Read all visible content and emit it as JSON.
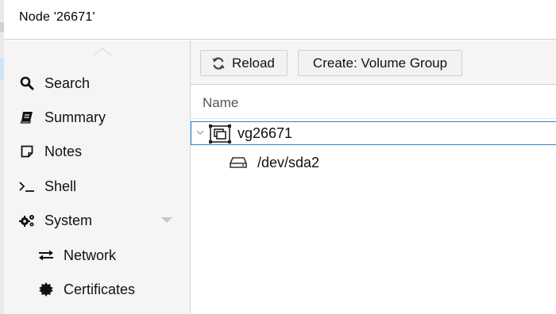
{
  "window": {
    "title": "Node '26671'"
  },
  "nav": {
    "items": [
      {
        "label": "Search",
        "icon": "search-icon"
      },
      {
        "label": "Summary",
        "icon": "book-icon"
      },
      {
        "label": "Notes",
        "icon": "note-icon"
      },
      {
        "label": "Shell",
        "icon": "terminal-icon"
      },
      {
        "label": "System",
        "icon": "gears-icon"
      },
      {
        "label": "Network",
        "icon": "exchange-icon"
      },
      {
        "label": "Certificates",
        "icon": "certificate-icon"
      }
    ]
  },
  "toolbar": {
    "reload_label": "Reload",
    "create_label": "Create: Volume Group"
  },
  "grid": {
    "header": "Name",
    "rows": [
      {
        "label": "vg26671",
        "icon": "volume-group-icon",
        "selected": true
      },
      {
        "label": "/dev/sda2",
        "icon": "hdd-icon"
      }
    ]
  },
  "colors": {
    "selection_border": "#2a84d6",
    "nav_background": "#f5f5f5",
    "toolbar_background": "#f5f5f5"
  }
}
